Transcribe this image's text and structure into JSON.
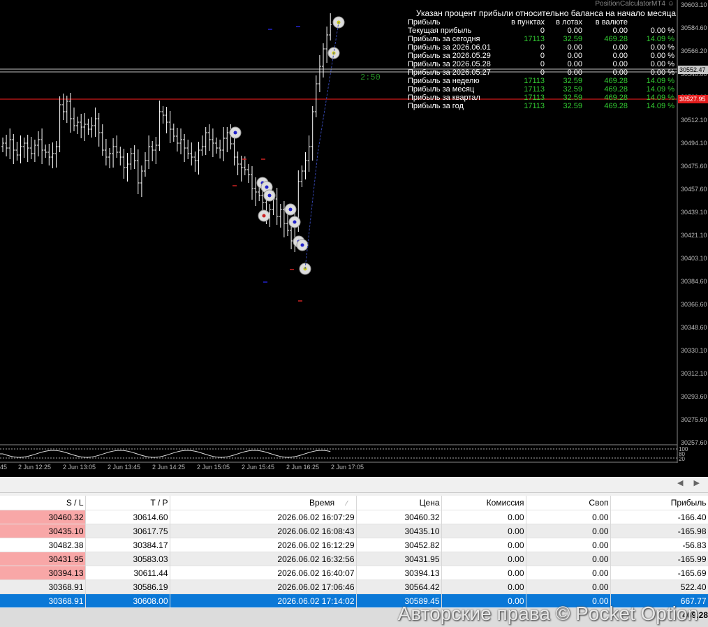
{
  "app": {
    "indicator_name": "PositionCalculatorMT4",
    "smile_icon": "smile-icon"
  },
  "chart": {
    "timer": "2:50",
    "price_axis": [
      "30603.10",
      "30584.60",
      "30566.20",
      "30548.00",
      "30530.10",
      "30512.10",
      "30494.10",
      "30475.60",
      "30457.60",
      "30439.10",
      "30421.10",
      "30403.10",
      "30384.60",
      "30366.60",
      "30348.60",
      "30330.10",
      "30312.10",
      "30293.60",
      "30275.60",
      "30257.60"
    ],
    "bid_tag": "30552.47",
    "red_tag": "30527.95",
    "time_axis": [
      "45",
      "2 Jun 12:25",
      "2 Jun 13:05",
      "2 Jun 13:45",
      "2 Jun 14:25",
      "2 Jun 15:05",
      "2 Jun 15:45",
      "2 Jun 16:25",
      "2 Jun 17:05"
    ],
    "osc_labels": [
      "100",
      "80",
      "20"
    ],
    "colors": {
      "background": "#000000",
      "candle": "#ffffff",
      "bid_line": "#c0c0c0",
      "red_line": "#ff2020",
      "profit_green": "#32cd32"
    }
  },
  "stats": {
    "header": "Указан процент прибыли относительно баланса на начало месяца",
    "columns": [
      "Прибыль",
      "в пунктах",
      "в лотах",
      "в валюте",
      ""
    ],
    "rows": [
      {
        "label": "Текущая прибыль",
        "points": "0",
        "lots": "0.00",
        "currency": "0.00",
        "percent": "0.00 %",
        "positive": false
      },
      {
        "label": "Прибыль за сегодня",
        "points": "17113",
        "lots": "32.59",
        "currency": "469.28",
        "percent": "14.09 %",
        "positive": true
      },
      {
        "label": "Прибыль за 2026.06.01",
        "points": "0",
        "lots": "0.00",
        "currency": "0.00",
        "percent": "0.00 %",
        "positive": false
      },
      {
        "label": "Прибыль за 2026.05.29",
        "points": "0",
        "lots": "0.00",
        "currency": "0.00",
        "percent": "0.00 %",
        "positive": false
      },
      {
        "label": "Прибыль за 2026.05.28",
        "points": "0",
        "lots": "0.00",
        "currency": "0.00",
        "percent": "0.00 %",
        "positive": false
      },
      {
        "label": "Прибыль за 2026.05.27",
        "points": "0",
        "lots": "0.00",
        "currency": "0.00",
        "percent": "0.00 %",
        "positive": false
      },
      {
        "label": "Прибыль за неделю",
        "points": "17113",
        "lots": "32.59",
        "currency": "469.28",
        "percent": "14.09 %",
        "positive": true
      },
      {
        "label": "Прибыль за месяц",
        "points": "17113",
        "lots": "32.59",
        "currency": "469.28",
        "percent": "14.09 %",
        "positive": true
      },
      {
        "label": "Прибыль за квартал",
        "points": "17113",
        "lots": "32.59",
        "currency": "469.28",
        "percent": "14.09 %",
        "positive": true
      },
      {
        "label": "Прибыль за год",
        "points": "17113",
        "lots": "32.59",
        "currency": "469.28",
        "percent": "14.09 %",
        "positive": true
      }
    ]
  },
  "terminal": {
    "columns": [
      "S / L",
      "T / P",
      "Время",
      "Цена",
      "Комиссия",
      "Своп",
      "Прибыль"
    ],
    "sort_indicator": "⁄",
    "rows": [
      {
        "sl": "30460.32",
        "tp": "30614.60",
        "time": "2026.06.02 16:07:29",
        "price": "30460.32",
        "commission": "0.00",
        "swap": "0.00",
        "profit": "-166.40",
        "sl_red": true
      },
      {
        "sl": "30435.10",
        "tp": "30617.75",
        "time": "2026.06.02 16:08:43",
        "price": "30435.10",
        "commission": "0.00",
        "swap": "0.00",
        "profit": "-165.98",
        "sl_red": true
      },
      {
        "sl": "30482.38",
        "tp": "30384.17",
        "time": "2026.06.02 16:12:29",
        "price": "30452.82",
        "commission": "0.00",
        "swap": "0.00",
        "profit": "-56.83",
        "sl_red": false
      },
      {
        "sl": "30431.95",
        "tp": "30583.03",
        "time": "2026.06.02 16:32:56",
        "price": "30431.95",
        "commission": "0.00",
        "swap": "0.00",
        "profit": "-165.99",
        "sl_red": true
      },
      {
        "sl": "30394.13",
        "tp": "30611.44",
        "time": "2026.06.02 16:40:07",
        "price": "30394.13",
        "commission": "0.00",
        "swap": "0.00",
        "profit": "-165.69",
        "sl_red": true
      },
      {
        "sl": "30368.91",
        "tp": "30586.19",
        "time": "2026.06.02 17:06:46",
        "price": "30564.42",
        "commission": "0.00",
        "swap": "0.00",
        "profit": "522.40",
        "sl_red": false
      },
      {
        "sl": "30368.91",
        "tp": "30608.00",
        "time": "2026.06.02 17:14:02",
        "price": "30589.45",
        "commission": "0.00",
        "swap": "0.00",
        "profit": "667.77",
        "sl_red": false,
        "selected": true
      }
    ],
    "total_profit": "469.28",
    "scroll_icons": "◀ ▶"
  },
  "watermark": "Авторские права © Pocket Option"
}
